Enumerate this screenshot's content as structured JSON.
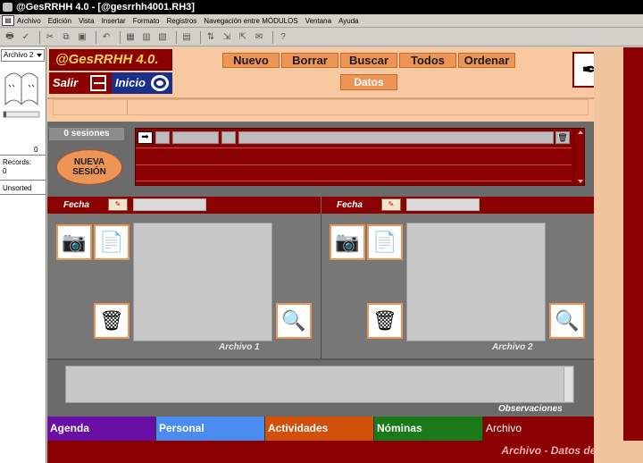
{
  "window": {
    "title": "@GesRRHH 4.0 - [@gesrrhh4001.RH3]"
  },
  "menu": {
    "items": [
      "Archivo",
      "Edición",
      "Vista",
      "Insertar",
      "Formato",
      "Registros",
      "Navegación entre MÓDULOS",
      "Ventana",
      "Ayuda"
    ]
  },
  "status": {
    "layout": "Archivo 2",
    "record_count": "0",
    "records_label": "Records:",
    "records_value": "0",
    "sort_state": "Unsorted"
  },
  "header": {
    "logo": "@GesRRHH 4.0.",
    "salir": "Salir",
    "inicio": "Inicio",
    "buttons": {
      "nuevo": "Nuevo",
      "borrar": "Borrar",
      "buscar": "Buscar",
      "todos": "Todos",
      "ordenar": "Ordenar"
    },
    "datos": "Datos"
  },
  "sessions": {
    "count_label": "0 sesiones",
    "new_button_line1": "NUEVA",
    "new_button_line2": "SESIÓN"
  },
  "documents": {
    "left": {
      "fecha_label": "Fecha",
      "file_label": "Archivo 1"
    },
    "right": {
      "fecha_label": "Fecha",
      "file_label": "Archivo 2"
    }
  },
  "observaciones": {
    "label": "Observaciones"
  },
  "tabs": [
    {
      "label": "Agenda",
      "color": "#6a0fa6"
    },
    {
      "label": "Personal",
      "color": "#4a8cf0"
    },
    {
      "label": "Actividades",
      "color": "#d2500a"
    },
    {
      "label": "Nóminas",
      "color": "#1a7a1a"
    },
    {
      "label": "Archivo",
      "color": "#8b0000"
    }
  ],
  "footer": {
    "text": "Archivo - Datos de Archivo"
  },
  "colors": {
    "brand_dark_red": "#8b0000",
    "accent_orange": "#ec9556",
    "header_bg": "#f8c9a0"
  }
}
